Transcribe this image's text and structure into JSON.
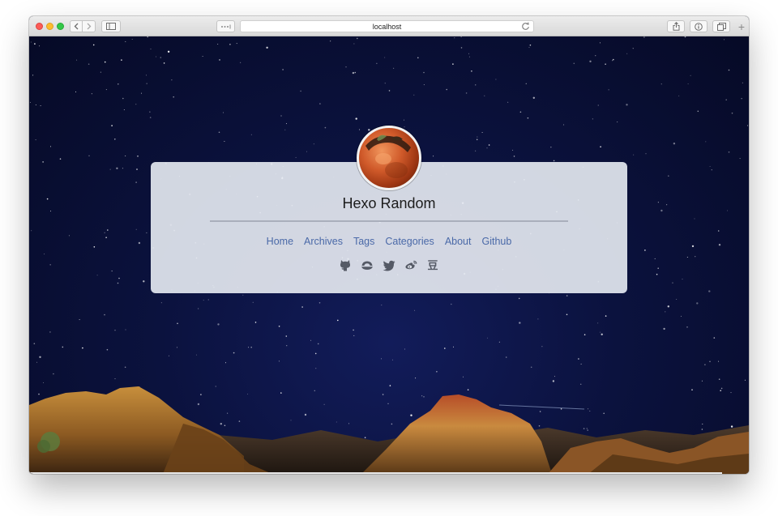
{
  "browser": {
    "address_url": "localhost"
  },
  "site": {
    "title": "Hexo Random",
    "nav": [
      {
        "label": "Home"
      },
      {
        "label": "Archives"
      },
      {
        "label": "Tags"
      },
      {
        "label": "Categories"
      },
      {
        "label": "About"
      },
      {
        "label": "Github"
      }
    ],
    "social_icons": [
      "github-icon",
      "zhihu-icon",
      "twitter-icon",
      "weibo-icon",
      "douban-icon"
    ],
    "douban_glyph": "豆"
  },
  "colors": {
    "nav_link": "#4a69a8",
    "card_background": "#e4e8f0",
    "sky": "#0b123e"
  }
}
